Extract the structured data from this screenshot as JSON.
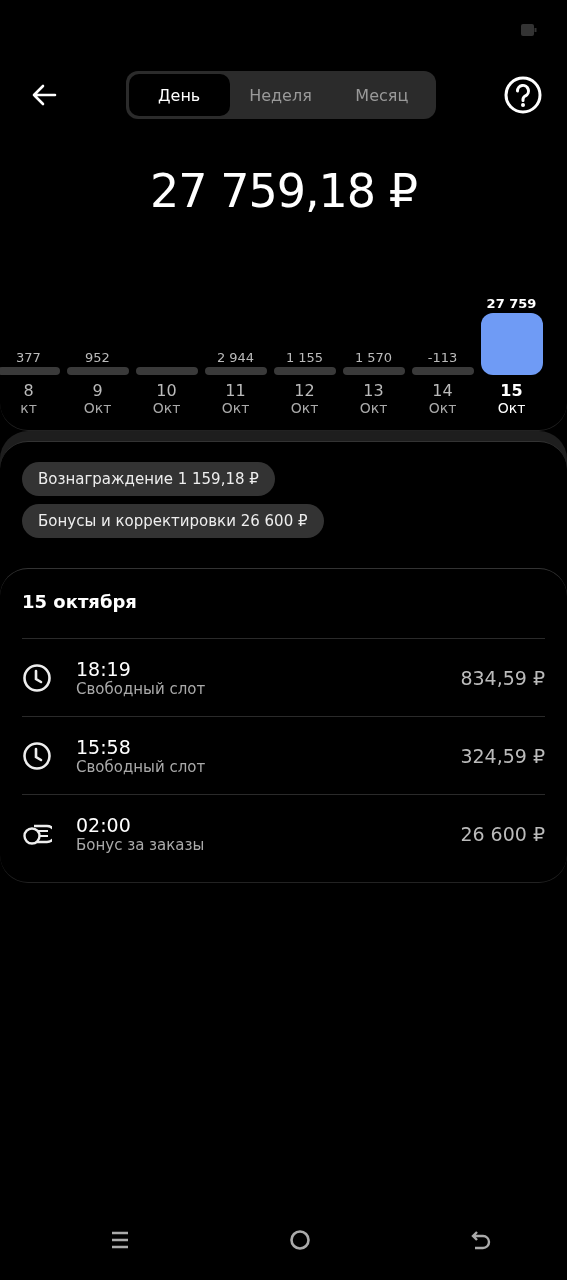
{
  "header": {
    "tabs": [
      {
        "label": "День",
        "selected": true
      },
      {
        "label": "Неделя",
        "selected": false
      },
      {
        "label": "Месяц",
        "selected": false
      }
    ]
  },
  "total": "27 759,18 ₽",
  "days": [
    {
      "value": "377",
      "day": "8",
      "month": "кт",
      "selected": false
    },
    {
      "value": "952",
      "day": "9",
      "month": "Окт",
      "selected": false
    },
    {
      "day": "10",
      "month": "Окт",
      "selected": false
    },
    {
      "value": "2 944",
      "day": "11",
      "month": "Окт",
      "selected": false
    },
    {
      "value": "1 155",
      "day": "12",
      "month": "Окт",
      "selected": false
    },
    {
      "value": "1 570",
      "day": "13",
      "month": "Окт",
      "selected": false
    },
    {
      "value": "-113",
      "day": "14",
      "month": "Окт",
      "selected": false
    },
    {
      "value": "27 759",
      "day": "15",
      "month": "Окт",
      "selected": true
    }
  ],
  "chips": [
    "Вознаграждение 1 159,18 ₽",
    "Бонусы и корректировки 26 600 ₽"
  ],
  "day_title": "15 октября",
  "entries": [
    {
      "kind": "slot",
      "time": "18:19",
      "title": "Свободный слот",
      "amount": "834,59 ₽"
    },
    {
      "kind": "slot",
      "time": "15:58",
      "title": "Свободный слот",
      "amount": "324,59 ₽"
    },
    {
      "kind": "bonus",
      "time": "02:00",
      "title": "Бонус за заказы",
      "amount": "26 600 ₽"
    }
  ]
}
